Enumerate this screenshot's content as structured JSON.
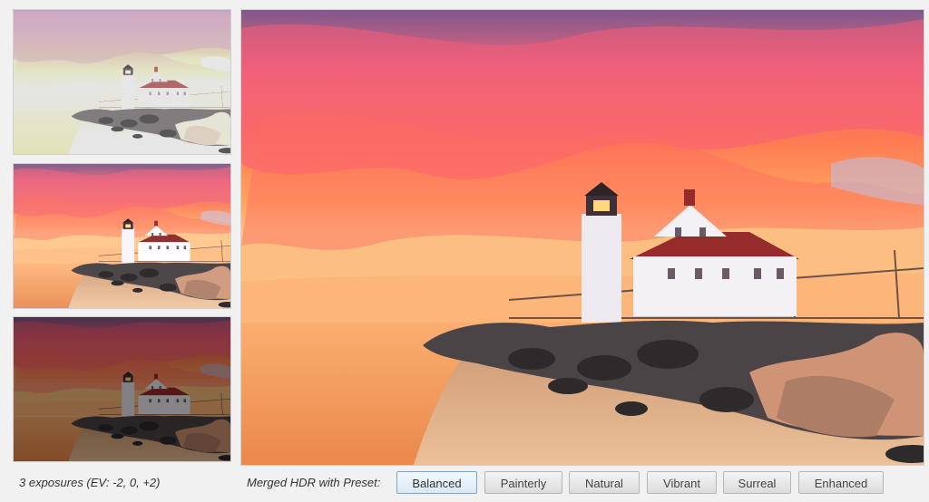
{
  "thumbnails": [
    {
      "exposure": "-2"
    },
    {
      "exposure": "0"
    },
    {
      "exposure": "+2"
    }
  ],
  "captions": {
    "exposures": "3 exposures (EV: -2, 0, +2)",
    "merged": "Merged HDR with Preset:"
  },
  "presets": {
    "selected": "Balanced",
    "items": [
      {
        "label": "Balanced"
      },
      {
        "label": "Painterly"
      },
      {
        "label": "Natural"
      },
      {
        "label": "Vibrant"
      },
      {
        "label": "Surreal"
      },
      {
        "label": "Enhanced"
      }
    ]
  },
  "colors": {
    "selected_border": "#7ea3c4",
    "button_border": "#b5b5b5",
    "background": "#f1f1f1"
  }
}
